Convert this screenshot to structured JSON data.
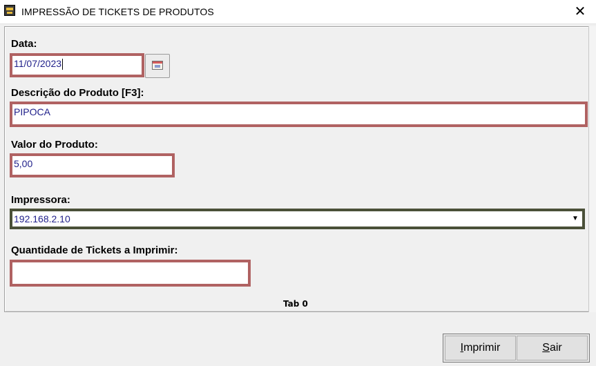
{
  "window": {
    "title": "IMPRESSÃO DE TICKETS DE PRODUTOS"
  },
  "form": {
    "date": {
      "label": "Data:",
      "value": "11/07/2023"
    },
    "product_description": {
      "label": "Descrição do Produto [F3]:",
      "value": "PIPOCA"
    },
    "product_value": {
      "label": "Valor do Produto:",
      "value": "5,00"
    },
    "printer": {
      "label": "Impressora:",
      "value": "192.168.2.10"
    },
    "ticket_quantity": {
      "label": "Quantidade de Tickets a Imprimir:",
      "value": ""
    }
  },
  "tab": {
    "label": "Tab 0"
  },
  "buttons": {
    "print": {
      "accel": "I",
      "rest": "mprimir"
    },
    "exit": {
      "accel": "S",
      "rest": "air"
    }
  },
  "colors": {
    "field_border": "#b06262",
    "printer_border": "#4a5038",
    "field_text": "#1f1f8a"
  },
  "icons": {
    "app": "app-icon",
    "close": "close-icon",
    "calendar": "calendar-icon",
    "dropdown": "chevron-down-icon"
  }
}
